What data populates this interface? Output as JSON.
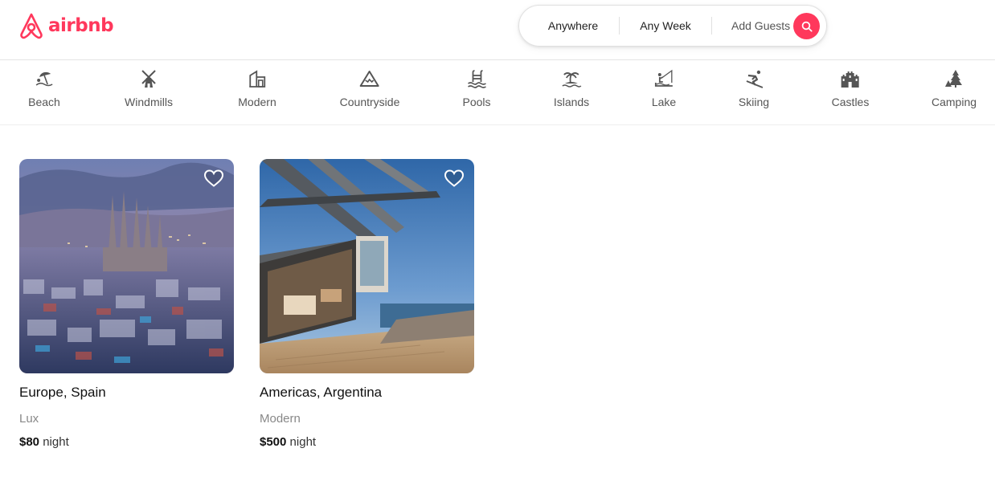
{
  "brand": {
    "name": "airbnb",
    "color": "#ff385c",
    "icon": "airbnb-logo-icon"
  },
  "search": {
    "anywhere": "Anywhere",
    "any_week": "Any Week",
    "add_guests": "Add Guests",
    "button_icon": "search-icon"
  },
  "categories": [
    {
      "label": "Beach",
      "icon": "beach-icon"
    },
    {
      "label": "Windmills",
      "icon": "windmill-icon"
    },
    {
      "label": "Modern",
      "icon": "modern-building-icon"
    },
    {
      "label": "Countryside",
      "icon": "mountain-icon"
    },
    {
      "label": "Pools",
      "icon": "pool-icon"
    },
    {
      "label": "Islands",
      "icon": "island-icon"
    },
    {
      "label": "Lake",
      "icon": "lake-fishing-icon"
    },
    {
      "label": "Skiing",
      "icon": "skiing-icon"
    },
    {
      "label": "Castles",
      "icon": "castle-icon"
    },
    {
      "label": "Camping",
      "icon": "camping-tree-icon"
    }
  ],
  "listings": [
    {
      "location": "Europe, Spain",
      "category": "Lux",
      "price": "$80",
      "price_unit": "night",
      "image": "barcelona-city-photo"
    },
    {
      "location": "Americas, Argentina",
      "category": "Modern",
      "price": "$500",
      "price_unit": "night",
      "image": "modern-beach-house-photo"
    }
  ]
}
